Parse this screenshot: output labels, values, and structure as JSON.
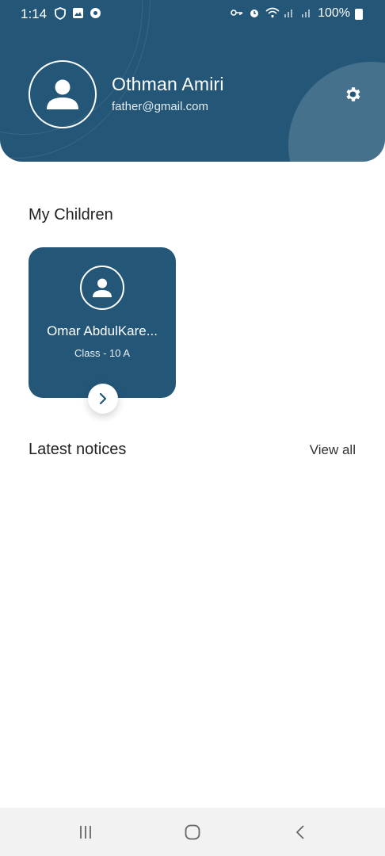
{
  "status_bar": {
    "time": "1:14",
    "battery": "100%",
    "icons": [
      "shield-icon",
      "gallery-icon",
      "notification-icon",
      "vpn-key-icon",
      "alarm-icon",
      "wifi-icon",
      "signal-icon",
      "signal-icon",
      "battery-icon"
    ]
  },
  "profile": {
    "name": "Othman Amiri",
    "email": "father@gmail.com",
    "settings_icon": "gear-icon"
  },
  "children_section": {
    "title": "My Children",
    "children": [
      {
        "name": "Omar AbdulKare...",
        "class": "Class - 10 A"
      }
    ]
  },
  "notices_section": {
    "title": "Latest notices",
    "view_all_label": "View all"
  },
  "nav": {
    "icons": [
      "recent-apps-icon",
      "home-icon",
      "back-icon"
    ]
  },
  "colors": {
    "primary": "#235677",
    "background": "#ffffff",
    "nav_background": "#f2f2f2"
  }
}
